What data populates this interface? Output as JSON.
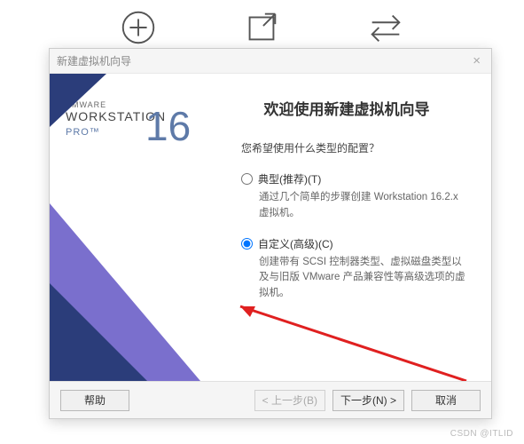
{
  "tiles": {
    "create": "创建新的虚拟机",
    "open": "打开虚拟机",
    "connect": "连接远程服务器"
  },
  "dialog": {
    "title": "新建虚拟机向导",
    "brand_super": "VMWARE",
    "brand": "WORKSTATION",
    "pro": "PRO™",
    "version": "16",
    "heading": "欢迎使用新建虚拟机向导",
    "prompt": "您希望使用什么类型的配置？",
    "opt_typical": {
      "label": "典型(推荐)(T)",
      "desc": "通过几个简单的步骤创建 Workstation 16.2.x 虚拟机。"
    },
    "opt_custom": {
      "label": "自定义(高级)(C)",
      "desc": "创建带有 SCSI 控制器类型、虚拟磁盘类型以及与旧版 VMware 产品兼容性等高级选项的虚拟机。"
    },
    "buttons": {
      "help": "帮助",
      "back": "< 上一步(B)",
      "next": "下一步(N) >",
      "cancel": "取消"
    }
  },
  "watermark": "CSDN @ITLID"
}
